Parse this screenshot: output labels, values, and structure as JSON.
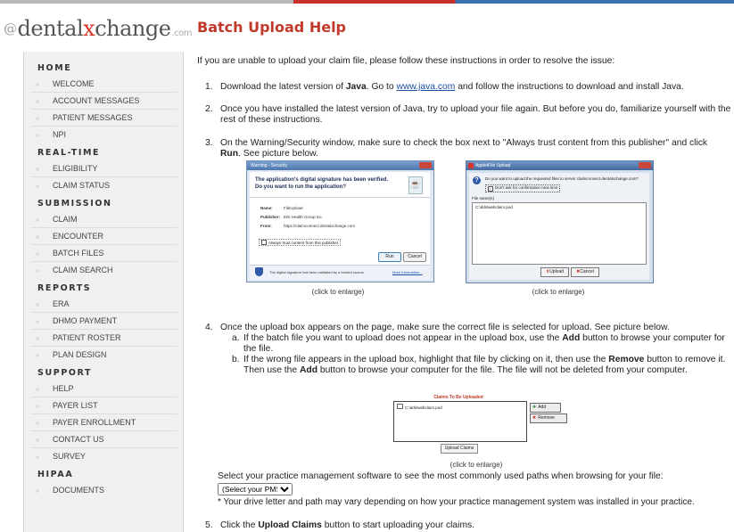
{
  "logo": {
    "prefix": "@",
    "part1": "dental",
    "part2": "x",
    "part3": "change",
    "suffix": ".com"
  },
  "sidebar": {
    "sections": [
      {
        "title": "HOME",
        "items": [
          "WELCOME",
          "ACCOUNT MESSAGES",
          "PATIENT MESSAGES",
          "NPI"
        ]
      },
      {
        "title": "REAL-TIME",
        "items": [
          "ELIGIBILITY",
          "CLAIM STATUS"
        ]
      },
      {
        "title": "SUBMISSION",
        "items": [
          "CLAIM",
          "ENCOUNTER",
          "BATCH FILES",
          "CLAIM SEARCH"
        ]
      },
      {
        "title": "REPORTS",
        "items": [
          "ERA",
          "DHMO PAYMENT",
          "PATIENT ROSTER",
          "PLAN DESIGN"
        ]
      },
      {
        "title": "SUPPORT",
        "items": [
          "HELP",
          "PAYER LIST",
          "PAYER ENROLLMENT",
          "CONTACT US",
          "SURVEY"
        ]
      },
      {
        "title": "HIPAA",
        "items": [
          "DOCUMENTS"
        ]
      }
    ]
  },
  "page": {
    "title": "Batch Upload Help",
    "intro": "If you are unable to upload your claim file, please follow these instructions in order to resolve the issue:",
    "step1": {
      "num": "1.",
      "a": "Download the latest version of ",
      "b": "Java",
      "c": ". Go to ",
      "link": "www.java.com",
      "d": " and follow the instructions to download and install Java."
    },
    "step2": {
      "num": "2.",
      "line1": "Once you have installed the latest version of Java, try to upload your file again. But before you do, familiarize yourself with the",
      "line2": "rest of these instructions."
    },
    "step3": {
      "num": "3.",
      "line1": "On the Warning/Security window, make sure to check the box next to \"Always trust content from this publisher\" and click",
      "b": "Run",
      "c": ". See picture below."
    },
    "shot1": {
      "titlebar": "Warning - Security",
      "heading1": "The application's digital signature has been verified.",
      "heading2": "Do you want to run the application?",
      "name_label": "Name:",
      "name_val": "FileUpload",
      "pub_label": "Publisher:",
      "pub_val": "EDI Health Group Inc.",
      "from_label": "From:",
      "from_val": "https://claimconnect.dentalxchange.com",
      "check": "Always trust content from this publisher",
      "run": "Run",
      "cancel": "Cancel",
      "footer": "The digital signature has been validated by a trusted source.",
      "more": "More Information..."
    },
    "shot2": {
      "titlebar": "AppletFile Upload",
      "question": "Do you want to upload the requested files to server claimconnect.dentalxchange.com?",
      "check": "Don't ask for confirmation next time",
      "files_label": "File name(s)",
      "file": "C:\\dds\\webclaim.pod",
      "upload": "Upload",
      "cancel": "Cancel"
    },
    "caption1": "(click to enlarge)",
    "caption2": "(click to enlarge)",
    "step4": {
      "num": "4.",
      "line1": "Once the upload box appears on the page, make sure the correct file is selected for upload. See picture below.",
      "a_label": "a.",
      "a1": "If the batch file you want to upload does not appear in the upload box, use the ",
      "a_b": "Add",
      "a2": " button to browse your computer for",
      "a3": "the file.",
      "b_label": "b.",
      "b1": "If the wrong file appears in the upload box, highlight that file by clicking on it, then use the ",
      "b_b": "Remove",
      "b2": " button to remove it.",
      "b3": "Then use the ",
      "b3_b": "Add",
      "b4": " button to browse your computer for the file. The file will not be deleted from your computer."
    },
    "shot3": {
      "title": "Claims To Be Uploaded",
      "file": "C:\\dds\\webclaim.pod",
      "add": "Add",
      "remove": "Remove",
      "upload": "Upload Claims"
    },
    "caption3": "(click to enlarge)",
    "pms_text": "Select your practice management software to see the most commonly used paths when browsing for your file:",
    "pms_select": "(Select your PMS)",
    "pms_note": "* Your drive letter and path may vary depending on how your practice management system was installed in your practice.",
    "step5": {
      "num": "5.",
      "a": "Click the ",
      "b": "Upload Claims",
      "c": " button to start uploading your claims."
    },
    "colors": {
      "title": "#c0392b",
      "link": "#1a4fa8",
      "logo_x": "#d9342b"
    }
  }
}
